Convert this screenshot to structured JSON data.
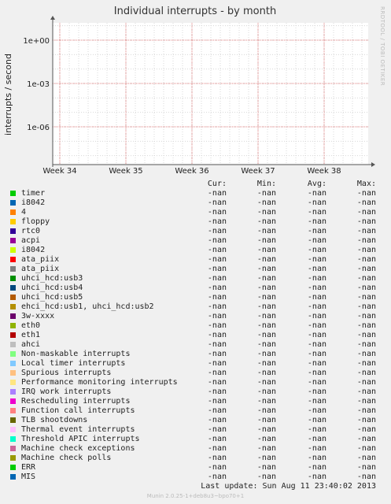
{
  "colors": {
    "grid_major": "#e08080",
    "grid_minor": "#d8d8d8",
    "plot_bg": "#ffffff",
    "axis": "#555555"
  },
  "chart_data": {
    "type": "line",
    "title": "Individual interrupts - by month",
    "ylabel": "interrupts / second",
    "yscale": "log",
    "ytick_labels": [
      "1e+00",
      "1e-03",
      "1e-06"
    ],
    "ytick_values": [
      1,
      0.001,
      1e-06
    ],
    "xtick_labels": [
      "Week 34",
      "Week 35",
      "Week 36",
      "Week 37",
      "Week 38"
    ],
    "grid": true,
    "side_text": "RRDTOOL / TOBI OETIKER",
    "series_values": "-nan"
  },
  "legend": {
    "headers": {
      "cur": "Cur:",
      "min": "Min:",
      "avg": "Avg:",
      "max": "Max:"
    },
    "rows": [
      {
        "name": "timer",
        "color": "#00cc00",
        "cur": "-nan",
        "min": "-nan",
        "avg": "-nan",
        "max": "-nan"
      },
      {
        "name": "i8042",
        "color": "#0066b3",
        "cur": "-nan",
        "min": "-nan",
        "avg": "-nan",
        "max": "-nan"
      },
      {
        "name": "4",
        "color": "#ff8000",
        "cur": "-nan",
        "min": "-nan",
        "avg": "-nan",
        "max": "-nan"
      },
      {
        "name": "floppy",
        "color": "#ffcc00",
        "cur": "-nan",
        "min": "-nan",
        "avg": "-nan",
        "max": "-nan"
      },
      {
        "name": "rtc0",
        "color": "#330099",
        "cur": "-nan",
        "min": "-nan",
        "avg": "-nan",
        "max": "-nan"
      },
      {
        "name": "acpi",
        "color": "#990099",
        "cur": "-nan",
        "min": "-nan",
        "avg": "-nan",
        "max": "-nan"
      },
      {
        "name": "i8042",
        "color": "#ccff00",
        "cur": "-nan",
        "min": "-nan",
        "avg": "-nan",
        "max": "-nan"
      },
      {
        "name": "ata_piix",
        "color": "#ff0000",
        "cur": "-nan",
        "min": "-nan",
        "avg": "-nan",
        "max": "-nan"
      },
      {
        "name": "ata_piix",
        "color": "#808080",
        "cur": "-nan",
        "min": "-nan",
        "avg": "-nan",
        "max": "-nan"
      },
      {
        "name": "uhci_hcd:usb3",
        "color": "#008f00",
        "cur": "-nan",
        "min": "-nan",
        "avg": "-nan",
        "max": "-nan"
      },
      {
        "name": "uhci_hcd:usb4",
        "color": "#00487d",
        "cur": "-nan",
        "min": "-nan",
        "avg": "-nan",
        "max": "-nan"
      },
      {
        "name": "uhci_hcd:usb5",
        "color": "#b35a00",
        "cur": "-nan",
        "min": "-nan",
        "avg": "-nan",
        "max": "-nan"
      },
      {
        "name": "ehci_hcd:usb1, uhci_hcd:usb2",
        "color": "#b38f00",
        "cur": "-nan",
        "min": "-nan",
        "avg": "-nan",
        "max": "-nan"
      },
      {
        "name": "3w-xxxx",
        "color": "#6b006b",
        "cur": "-nan",
        "min": "-nan",
        "avg": "-nan",
        "max": "-nan"
      },
      {
        "name": "eth0",
        "color": "#8fb300",
        "cur": "-nan",
        "min": "-nan",
        "avg": "-nan",
        "max": "-nan"
      },
      {
        "name": "eth1",
        "color": "#b30000",
        "cur": "-nan",
        "min": "-nan",
        "avg": "-nan",
        "max": "-nan"
      },
      {
        "name": "ahci",
        "color": "#bebebe",
        "cur": "-nan",
        "min": "-nan",
        "avg": "-nan",
        "max": "-nan"
      },
      {
        "name": "Non-maskable interrupts",
        "color": "#80ff80",
        "cur": "-nan",
        "min": "-nan",
        "avg": "-nan",
        "max": "-nan"
      },
      {
        "name": "Local timer interrupts",
        "color": "#80c9ff",
        "cur": "-nan",
        "min": "-nan",
        "avg": "-nan",
        "max": "-nan"
      },
      {
        "name": "Spurious interrupts",
        "color": "#ffc080",
        "cur": "-nan",
        "min": "-nan",
        "avg": "-nan",
        "max": "-nan"
      },
      {
        "name": "Performance monitoring interrupts",
        "color": "#ffe680",
        "cur": "-nan",
        "min": "-nan",
        "avg": "-nan",
        "max": "-nan"
      },
      {
        "name": "IRQ work interrupts",
        "color": "#aa80ff",
        "cur": "-nan",
        "min": "-nan",
        "avg": "-nan",
        "max": "-nan"
      },
      {
        "name": "Rescheduling interrupts",
        "color": "#ee00cc",
        "cur": "-nan",
        "min": "-nan",
        "avg": "-nan",
        "max": "-nan"
      },
      {
        "name": "Function call interrupts",
        "color": "#ff8080",
        "cur": "-nan",
        "min": "-nan",
        "avg": "-nan",
        "max": "-nan"
      },
      {
        "name": "TLB shootdowns",
        "color": "#666600",
        "cur": "-nan",
        "min": "-nan",
        "avg": "-nan",
        "max": "-nan"
      },
      {
        "name": "Thermal event interrupts",
        "color": "#ffbfff",
        "cur": "-nan",
        "min": "-nan",
        "avg": "-nan",
        "max": "-nan"
      },
      {
        "name": "Threshold APIC interrupts",
        "color": "#00ffcc",
        "cur": "-nan",
        "min": "-nan",
        "avg": "-nan",
        "max": "-nan"
      },
      {
        "name": "Machine check exceptions",
        "color": "#cc6699",
        "cur": "-nan",
        "min": "-nan",
        "avg": "-nan",
        "max": "-nan"
      },
      {
        "name": "Machine check polls",
        "color": "#999900",
        "cur": "-nan",
        "min": "-nan",
        "avg": "-nan",
        "max": "-nan"
      },
      {
        "name": "ERR",
        "color": "#00cc00",
        "cur": "-nan",
        "min": "-nan",
        "avg": "-nan",
        "max": "-nan"
      },
      {
        "name": "MIS",
        "color": "#0066b3",
        "cur": "-nan",
        "min": "-nan",
        "avg": "-nan",
        "max": "-nan"
      }
    ]
  },
  "last_update": "Last update:  Sun Aug 11 23:40:02 2013",
  "footer": "Munin 2.0.25-1+deb8u3~bpo70+1"
}
